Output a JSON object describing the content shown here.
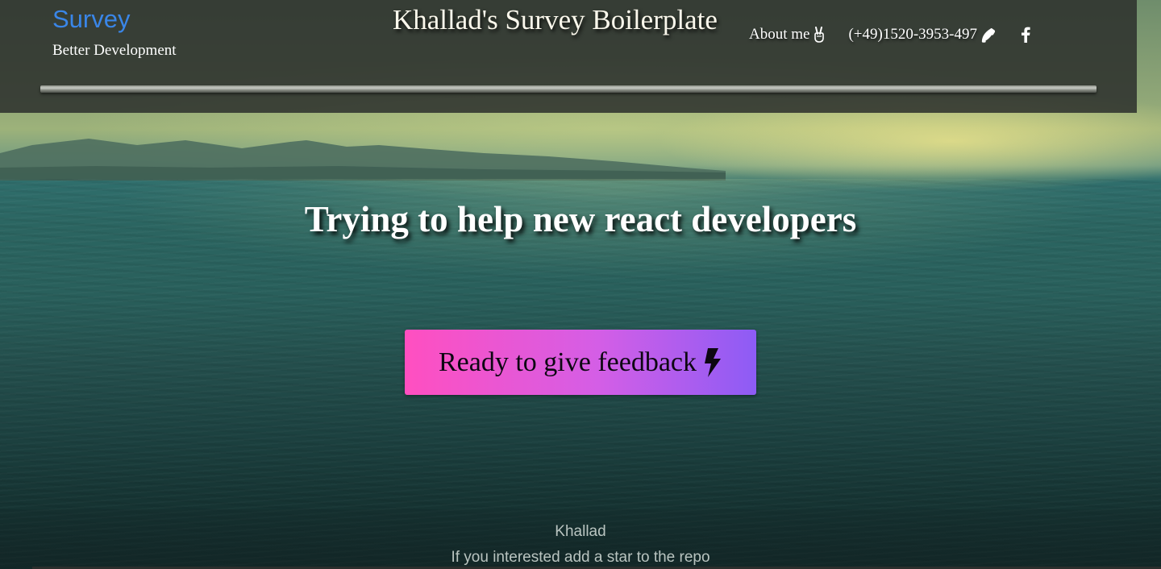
{
  "header": {
    "brand": "Survey",
    "tagline": "Better Development",
    "title": "Khallad's Survey Boilerplate",
    "nav": {
      "about_label": "About me",
      "about_icon": "victory-hand-icon",
      "phone_label": "(+49)1520-3953-497",
      "phone_icon": "phone-icon",
      "facebook_icon": "facebook-icon"
    }
  },
  "hero": {
    "heading": "Trying to help new react developers",
    "cta_label": "Ready to give feedback",
    "cta_icon": "bolt-icon"
  },
  "footer": {
    "author": "Khallad",
    "note": "If you interested add a star to the repo"
  },
  "colors": {
    "brand": "#3a86e8",
    "cta_gradient_start": "#ff4fc0",
    "cta_gradient_end": "#8d5cf5",
    "header_bg": "#2c302c"
  }
}
